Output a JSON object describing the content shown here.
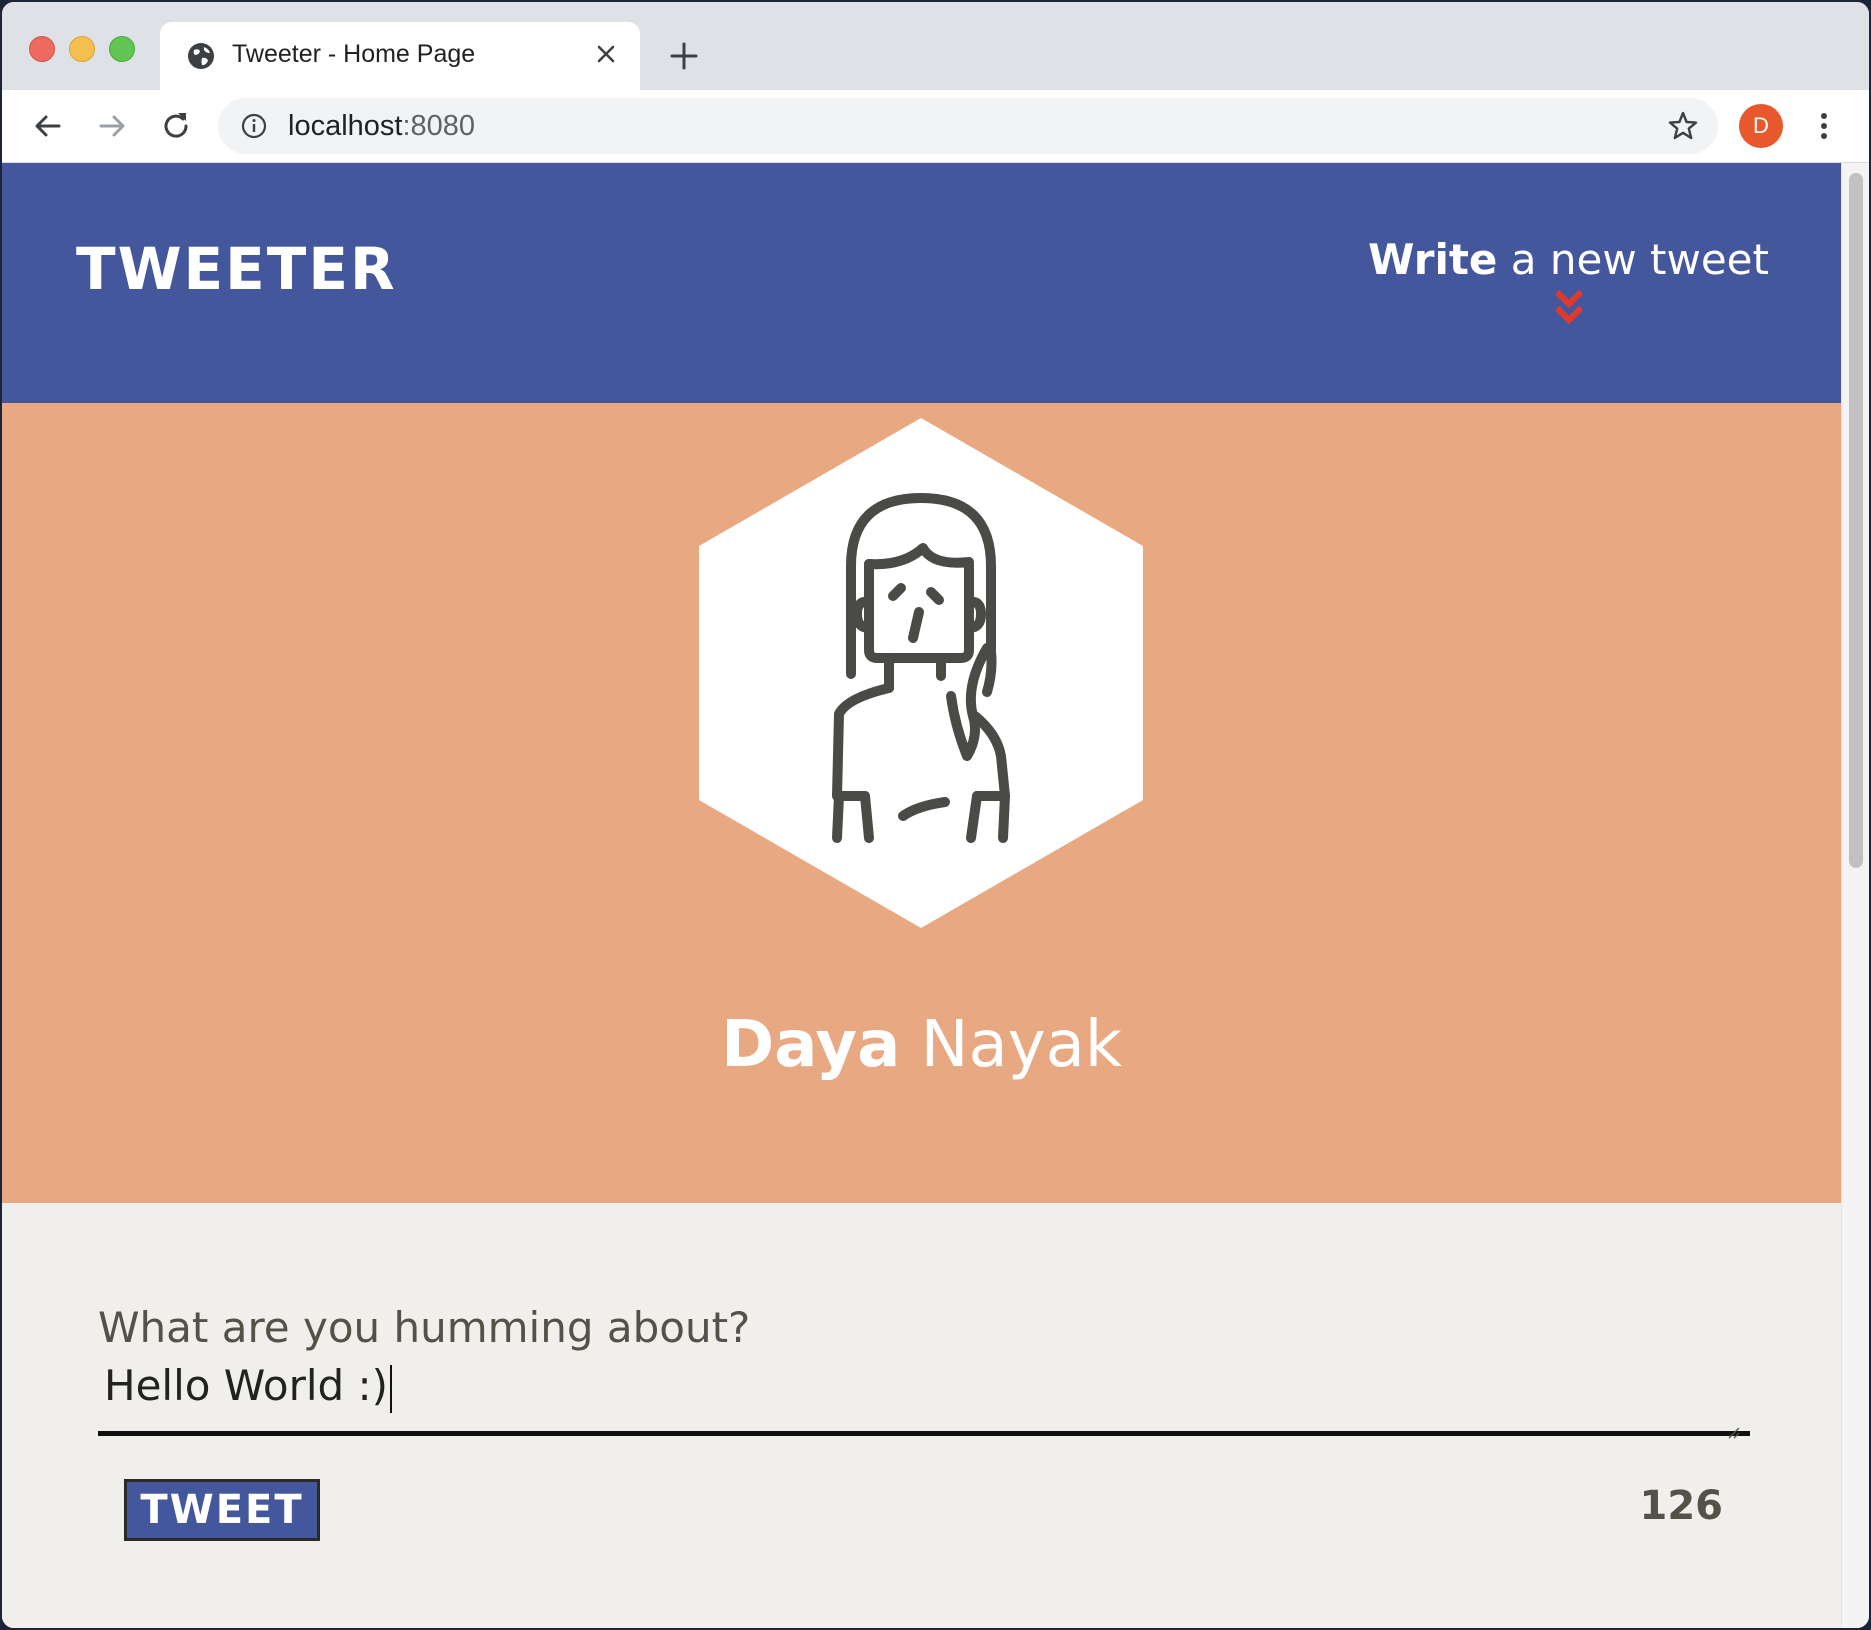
{
  "browser": {
    "tab_title": "Tweeter - Home Page",
    "url_host": "localhost",
    "url_port": ":8080",
    "profile_initial": "D"
  },
  "nav": {
    "brand": "TWEETER",
    "compose_bold": "Write",
    "compose_rest": " a new tweet"
  },
  "profile": {
    "first_name": "Daya",
    "last_name": " Nayak"
  },
  "composer": {
    "label": "What are you humming about?",
    "value": "Hello World :)",
    "submit_label": "TWEET",
    "counter": "126"
  },
  "colors": {
    "nav_bg": "#44579c",
    "banner_bg": "#e8a982",
    "accent_red": "#e03a2e",
    "page_bg": "#f0efeb"
  },
  "icons": {
    "favicon": "globe-icon",
    "compose": "double-chevron-down-icon",
    "avatar": "woman-avatar-icon"
  }
}
